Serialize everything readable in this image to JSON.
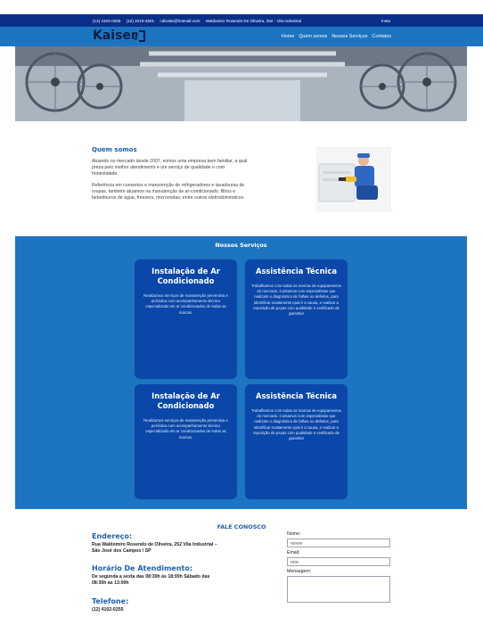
{
  "topbar": {
    "phone1": "(12) 4102-0255",
    "phone2": "(12) 3219-4601",
    "email": "cditvale@hotmail.com",
    "address": "Waldomiro Rosendo De Oliveira, 252 - Vila Industrial",
    "social": "Insta"
  },
  "brand": {
    "name": "Kaiser"
  },
  "nav": {
    "items": [
      "Home",
      "Quem somos",
      "Nossos Serviços",
      "Contatos"
    ]
  },
  "about": {
    "title": "Quem somos",
    "p1": "Atuando no mercado desde 2007, somos uma empresa bem familiar, a qual preza pelo melhor atendimento e um serviço de qualidade e com honestidade.",
    "p2": "Referência em consertos e manutenção de refrigeradores e lavadouras de roupas, também atuamos na manutenção de ar-condicionado, filtros e bebedouros de água, freezers, microondas, entre outros eletrodomésticos."
  },
  "services": {
    "title": "Nossos Serviços",
    "cards": [
      {
        "title": "Instalação de Ar Condicionado",
        "text": "Realizamos serviços de manutenção preventiva e periódica com acompanhamento técnico especializado em ar condicionados de todas as marcas."
      },
      {
        "title": "Assistência Técnica",
        "text": "Trabalhamos com todas as marcas de equipamentos do mercado. Contamos com especialistas que realizam o diagnóstico de falhas ou defeitos, para identificar exatamente qual é a causa, e realizar a reposição de peças com qualidade e certificado de garantia!"
      },
      {
        "title": "Instalação de Ar Condicionado",
        "text": "Realizamos serviços de manutenção preventiva e periódica com acompanhamento técnico especializado em ar condicionados de todas as marcas."
      },
      {
        "title": "Assistência Técnica",
        "text": "Trabalhamos com todas as marcas de equipamentos do mercado. Contamos com especialistas que realizam o diagnóstico de falhas ou defeitos, para identificar exatamente qual é a causa, e realizar a reposição de peças com qualidade e certificado de garantia!"
      }
    ]
  },
  "contact": {
    "title": "FALE CONOSCO",
    "address_title": "Endereço:",
    "address_text": "Rua Waldomiro Rosendo de Oliveira, 252 Vila Industrial – São José dos Campos / SP",
    "hours_title": "Horário De Atendimento:",
    "hours_text": "De segunda a sexta das 08:30h às 18:00h Sábado das 08:30h às 13:00h",
    "phone_title": "Telefone:",
    "phone_text": "(12) 4102-0255"
  },
  "form": {
    "name_label": "Nome:",
    "name_value": "rerere",
    "email_label": "Email:",
    "email_value": "rere",
    "message_label": "Mensagem:"
  }
}
